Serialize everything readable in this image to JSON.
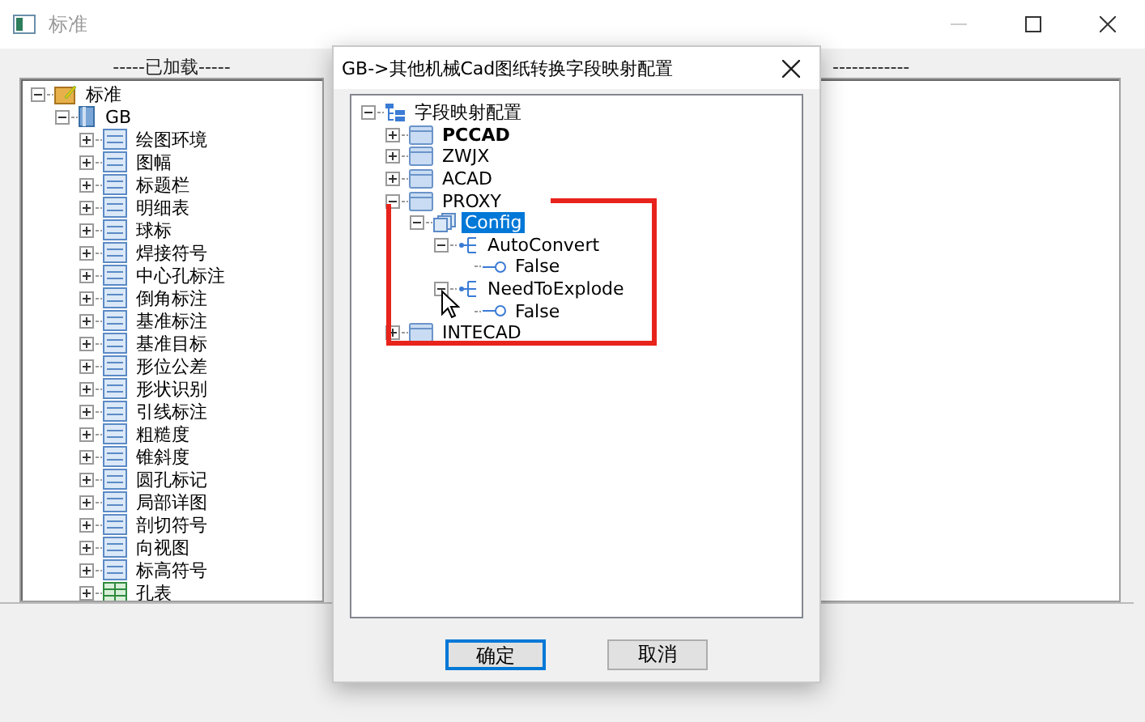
{
  "window": {
    "title": "标准"
  },
  "loaded_panel": {
    "label": "-----已加载-----",
    "tree": [
      {
        "label": "标准",
        "kind": "folder",
        "expanded": true,
        "children": [
          {
            "label": "GB",
            "kind": "book",
            "expanded": true,
            "children": [
              {
                "label": "绘图环境",
                "kind": "item",
                "expanded": false
              },
              {
                "label": "图幅",
                "kind": "item",
                "expanded": false
              },
              {
                "label": "标题栏",
                "kind": "item",
                "expanded": false
              },
              {
                "label": "明细表",
                "kind": "item",
                "expanded": false
              },
              {
                "label": "球标",
                "kind": "item",
                "expanded": false
              },
              {
                "label": "焊接符号",
                "kind": "item",
                "expanded": false
              },
              {
                "label": "中心孔标注",
                "kind": "item",
                "expanded": false
              },
              {
                "label": "倒角标注",
                "kind": "item",
                "expanded": false
              },
              {
                "label": "基准标注",
                "kind": "item",
                "expanded": false
              },
              {
                "label": "基准目标",
                "kind": "item",
                "expanded": false
              },
              {
                "label": "形位公差",
                "kind": "item",
                "expanded": false
              },
              {
                "label": "形状识别",
                "kind": "item",
                "expanded": false
              },
              {
                "label": "引线标注",
                "kind": "item",
                "expanded": false
              },
              {
                "label": "粗糙度",
                "kind": "item",
                "expanded": false
              },
              {
                "label": "锥斜度",
                "kind": "item",
                "expanded": false
              },
              {
                "label": "圆孔标记",
                "kind": "item",
                "expanded": false
              },
              {
                "label": "局部详图",
                "kind": "item",
                "expanded": false
              },
              {
                "label": "剖切符号",
                "kind": "item",
                "expanded": false
              },
              {
                "label": "向视图",
                "kind": "item",
                "expanded": false
              },
              {
                "label": "标高符号",
                "kind": "item",
                "expanded": false
              },
              {
                "label": "孔表",
                "kind": "table",
                "expanded": false
              }
            ]
          }
        ]
      }
    ]
  },
  "right_panel": {
    "label": "------------"
  },
  "dialog": {
    "title": "GB->其他机械Cad图纸转换字段映射配置",
    "tree": [
      {
        "label": "字段映射配置",
        "kind": "root",
        "expanded": true,
        "selected": false,
        "bold": false,
        "children": [
          {
            "label": "PCCAD",
            "kind": "panel",
            "expanded": false,
            "selected": false,
            "bold": true
          },
          {
            "label": "ZWJX",
            "kind": "panel",
            "expanded": false,
            "selected": false,
            "bold": false
          },
          {
            "label": "ACAD",
            "kind": "panel",
            "expanded": false,
            "selected": false,
            "bold": false
          },
          {
            "label": "PROXY",
            "kind": "panel",
            "expanded": true,
            "selected": false,
            "bold": false,
            "children": [
              {
                "label": "Config",
                "kind": "config",
                "expanded": true,
                "selected": true,
                "bold": false,
                "children": [
                  {
                    "label": "AutoConvert",
                    "kind": "property",
                    "expanded": true,
                    "selected": false,
                    "bold": false,
                    "children": [
                      {
                        "label": "False",
                        "kind": "value",
                        "selected": false,
                        "bold": false
                      }
                    ]
                  },
                  {
                    "label": "NeedToExplode",
                    "kind": "property",
                    "expanded": true,
                    "selected": false,
                    "bold": false,
                    "children": [
                      {
                        "label": "False",
                        "kind": "value",
                        "selected": false,
                        "bold": false
                      }
                    ]
                  }
                ]
              }
            ]
          },
          {
            "label": "INTECAD",
            "kind": "panel",
            "expanded": false,
            "selected": false,
            "bold": false
          }
        ]
      }
    ],
    "buttons": [
      {
        "label": "确定",
        "default": true
      },
      {
        "label": "取消",
        "default": false
      }
    ]
  }
}
